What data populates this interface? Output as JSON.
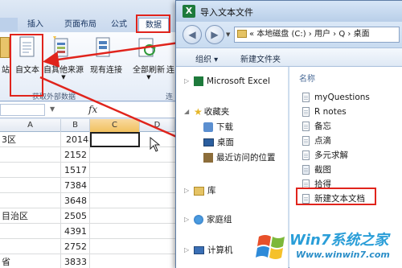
{
  "excel": {
    "tabs": [
      "插入",
      "页面布局",
      "公式",
      "数据"
    ],
    "ribbon": {
      "from_text": "自文本",
      "from_other": "自其他来源",
      "existing_conn": "现有连接",
      "refresh_all": "全部刷新",
      "partial_left": "站",
      "partial_right": "连",
      "group_label": "获取外部数据",
      "partial_group": "连"
    },
    "fx_label": "fx",
    "columns": [
      "A",
      "B",
      "C",
      "D"
    ],
    "rows": [
      {
        "a": "3区",
        "b": "2014年"
      },
      {
        "a": "",
        "b": "2152"
      },
      {
        "a": "",
        "b": "1517"
      },
      {
        "a": "",
        "b": "7384"
      },
      {
        "a": "",
        "b": "3648"
      },
      {
        "a": "目治区",
        "b": "2505"
      },
      {
        "a": "",
        "b": "4391"
      },
      {
        "a": "",
        "b": "2752"
      },
      {
        "a": "省",
        "b": "3833"
      },
      {
        "a": "",
        "b": "2426"
      },
      {
        "a": "",
        "b": "7960"
      }
    ]
  },
  "dialog": {
    "title": "导入文本文件",
    "address": "« 本地磁盘 (C:) › 用户 › Q › 桌面",
    "toolbar": {
      "organize": "组织 ▾",
      "new_folder": "新建文件夹"
    },
    "nav": {
      "excel": "Microsoft Excel",
      "favorites": "收藏夹",
      "downloads": "下载",
      "desktop": "桌面",
      "recent": "最近访问的位置",
      "library": "库",
      "homegroup": "家庭组",
      "computer": "计算机"
    },
    "column_name": "名称",
    "files": [
      "myQuestions",
      "R notes",
      "备忘",
      "点滴",
      "多元求解",
      "截图",
      "拾得",
      "新建文本文档"
    ]
  },
  "watermark": {
    "text": "Win7系统之家",
    "url": "Www.winwin7.com"
  },
  "colors": {
    "highlight": "#e0241c",
    "accent": "#1e7a3c"
  }
}
